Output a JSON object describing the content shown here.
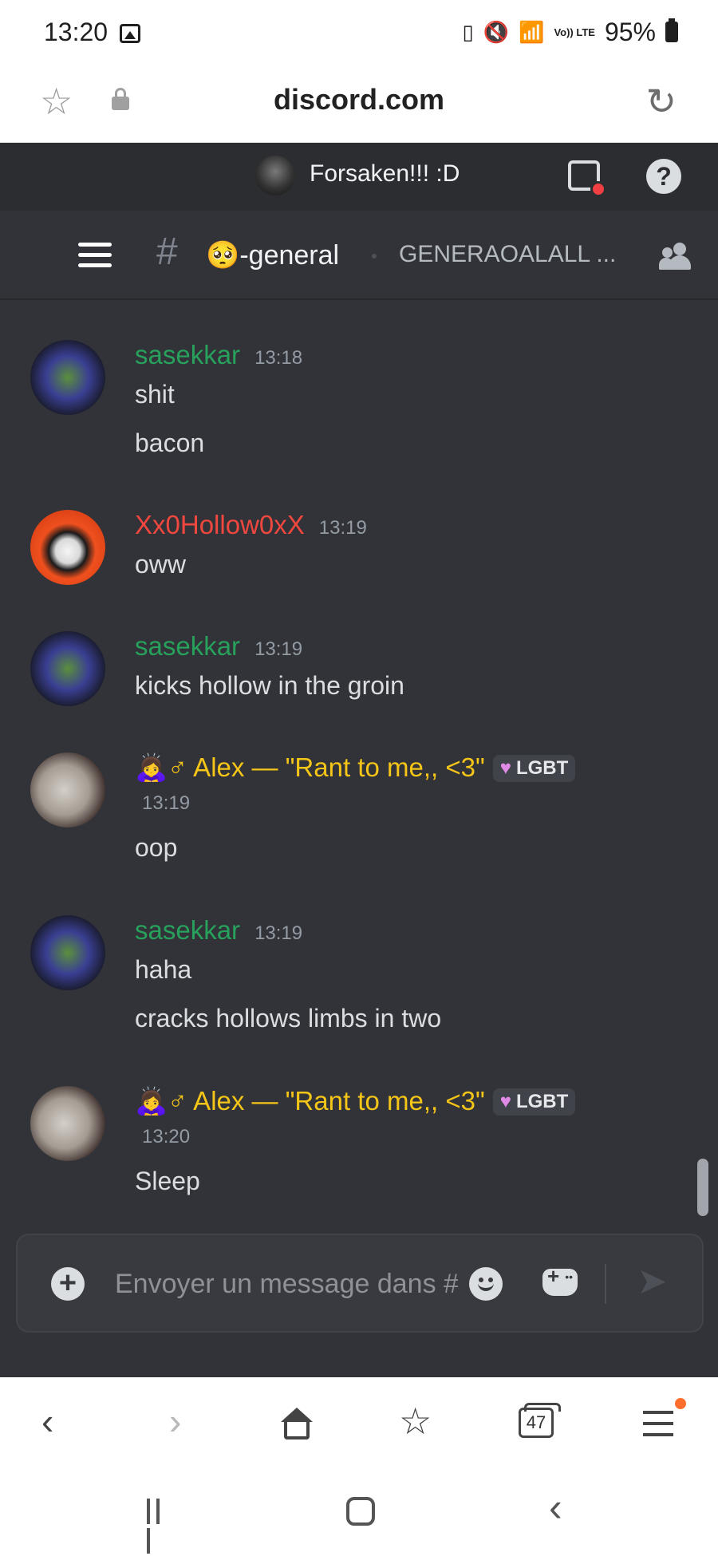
{
  "status_bar": {
    "time": "13:20",
    "battery": "95%",
    "network": "Vo)) LTE"
  },
  "browser": {
    "url": "discord.com",
    "tabs_count": "47"
  },
  "server": {
    "name": "Forsaken!!! :D"
  },
  "channel": {
    "name": "🥺-general",
    "topic": "GENERAOALALL ..."
  },
  "messages": [
    {
      "author": "sasekkar",
      "author_color": "#27a15b",
      "time": "13:18",
      "lines": [
        "shit",
        "bacon"
      ]
    },
    {
      "author": "Xx0Hollow0xX",
      "author_color": "#f0473e",
      "time": "13:19",
      "lines": [
        "oww"
      ]
    },
    {
      "author": "sasekkar",
      "author_color": "#27a15b",
      "time": "13:19",
      "lines": [
        "kicks hollow in the groin"
      ]
    },
    {
      "author": "🙇‍♀️♂ Alex — \"Rant to me,, <3\"",
      "author_color": "#f5c518",
      "badge": "LGBT",
      "time": "13:19",
      "lines": [
        "oop"
      ]
    },
    {
      "author": "sasekkar",
      "author_color": "#27a15b",
      "time": "13:19",
      "lines": [
        "haha",
        "cracks hollows limbs in two"
      ]
    },
    {
      "author": "🙇‍♀️♂ Alex — \"Rant to me,, <3\"",
      "author_color": "#f5c518",
      "badge": "LGBT",
      "time": "13:20",
      "lines": [
        "Sleep"
      ]
    }
  ],
  "composer": {
    "placeholder": "Envoyer un message dans #"
  },
  "icons": {
    "send": "➤",
    "star": "☆",
    "reload": "↻",
    "back": "‹",
    "forward": "›"
  }
}
